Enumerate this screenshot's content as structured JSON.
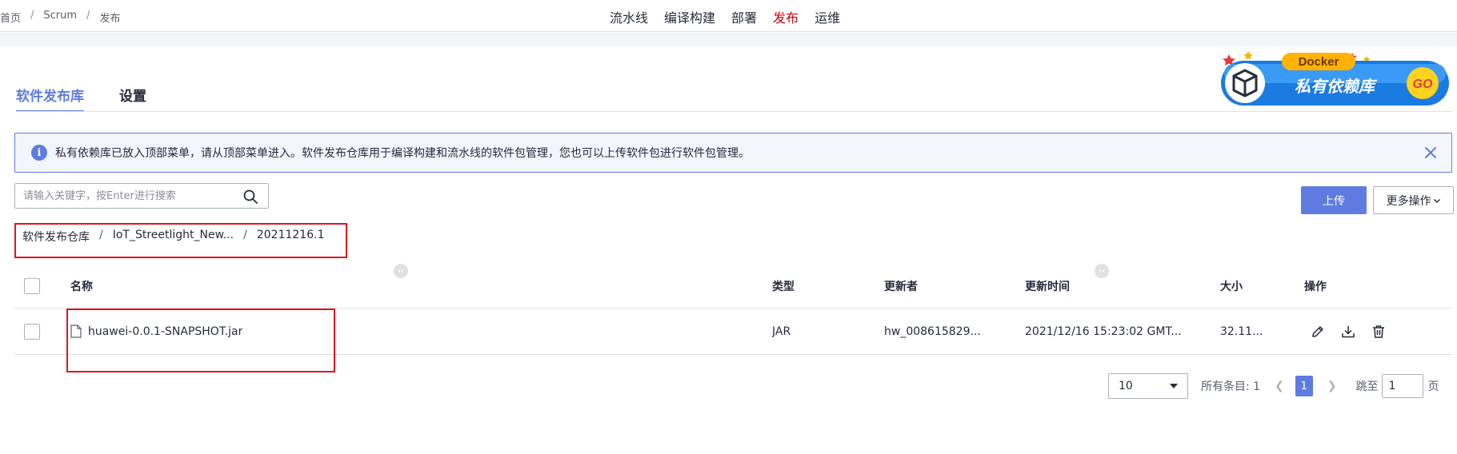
{
  "breadcrumb": [
    "首页",
    "Scrum",
    "发布"
  ],
  "breadcrumb_sep": "/",
  "topnav": [
    {
      "label": "流水线"
    },
    {
      "label": "编译构建"
    },
    {
      "label": "部署"
    },
    {
      "label": "发布",
      "active": true
    },
    {
      "label": "运维"
    }
  ],
  "tabs": [
    {
      "label": "软件发布库",
      "active": true
    },
    {
      "label": "设置"
    }
  ],
  "banner": {
    "badge": "Docker",
    "title": "私有依赖库",
    "go": "GO"
  },
  "notice": {
    "text": "私有依赖库已放入顶部菜单，请从顶部菜单进入。软件发布仓库用于编译构建和流水线的软件包管理，您也可以上传软件包进行软件包管理。"
  },
  "search": {
    "placeholder": "请输入关键字，按Enter进行搜索",
    "value": ""
  },
  "buttons": {
    "upload": "上传",
    "more": "更多操作"
  },
  "path": [
    "软件发布仓库",
    "IoT_Streetlight_New...",
    "20211216.1"
  ],
  "table": {
    "columns": [
      "名称",
      "类型",
      "更新者",
      "更新时间",
      "大小",
      "操作"
    ],
    "rows": [
      {
        "name": "huawei-0.0.1-SNAPSHOT.jar",
        "type": "JAR",
        "updater": "hw_008615829...",
        "time": "2021/12/16 15:23:02 GMT...",
        "size": "32.11..."
      }
    ]
  },
  "pagination": {
    "page_size": "10",
    "total_label": "所有条目: 1",
    "current_page": "1",
    "jump_label": "跳至",
    "jump_value": "1",
    "jump_suffix": "页"
  },
  "colors": {
    "accent": "#5e7ce0",
    "active_nav": "#c7000b",
    "annotation": "#e0141e"
  },
  "icons": [
    "info-icon",
    "close-icon",
    "search-icon",
    "file-icon",
    "edit-icon",
    "download-icon",
    "delete-icon",
    "chevron-down-icon"
  ]
}
